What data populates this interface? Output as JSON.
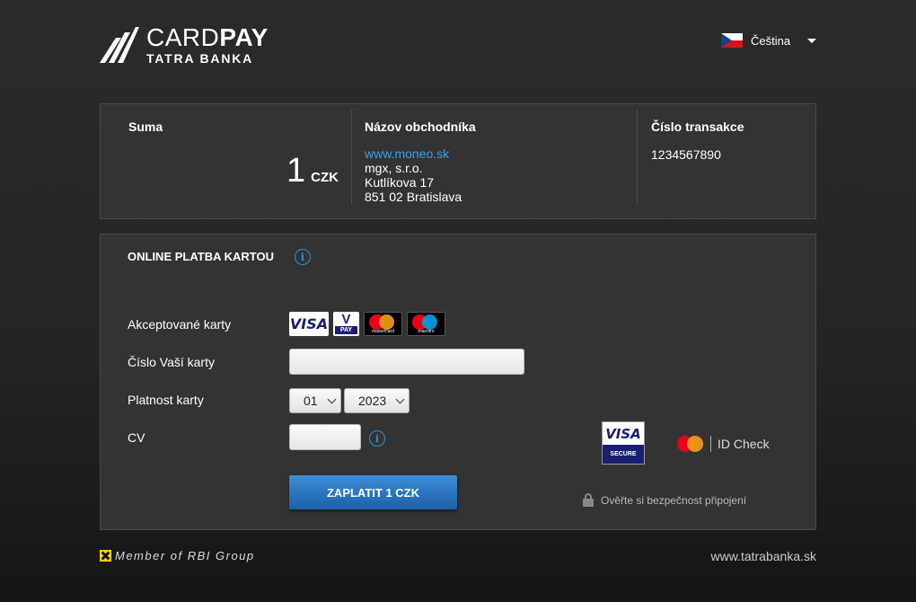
{
  "header": {
    "logo_primary_light": "CARD",
    "logo_primary_bold": "PAY",
    "logo_secondary": "TATRA BANKA",
    "language": "Čeština"
  },
  "summary": {
    "amount_label": "Suma",
    "amount_value": "1",
    "amount_currency": "CZK",
    "merchant_label": "Názov obchodníka",
    "merchant_url": "www.moneo.sk",
    "merchant_name": "mgx, s.r.o.",
    "merchant_street": "Kutlíkova 17",
    "merchant_city": "851 02 Bratislava",
    "transaction_label": "Číslo transakce",
    "transaction_id": "1234567890"
  },
  "payment": {
    "title": "ONLINE PLATBA KARTOU",
    "accepted_label": "Akceptované karty",
    "card_brands": {
      "visa": "VISA",
      "vpay_top": "V",
      "vpay_bottom": "PAY",
      "mastercard": "mastercard",
      "maestro": "maestro"
    },
    "card_number_label": "Číslo Vaší karty",
    "card_number_value": "",
    "validity_label": "Platnost karty",
    "month_value": "01",
    "year_value": "2023",
    "cvv_label": "CV",
    "cvv_value": "",
    "pay_button_label": "ZAPLATIT 1 CZK",
    "visa_secure_top": "VISA",
    "visa_secure_bottom": "SECURE",
    "id_check_label": "ID Check",
    "security_note": "Ověřte si bezpečnost připojení"
  },
  "footer": {
    "rbi_text": "Member of RBI Group",
    "website": "www.tatrabanka.sk"
  },
  "colors": {
    "accent_blue": "#1b5fa8",
    "link_blue": "#3aa0ea",
    "panel_bg": "#333333"
  }
}
